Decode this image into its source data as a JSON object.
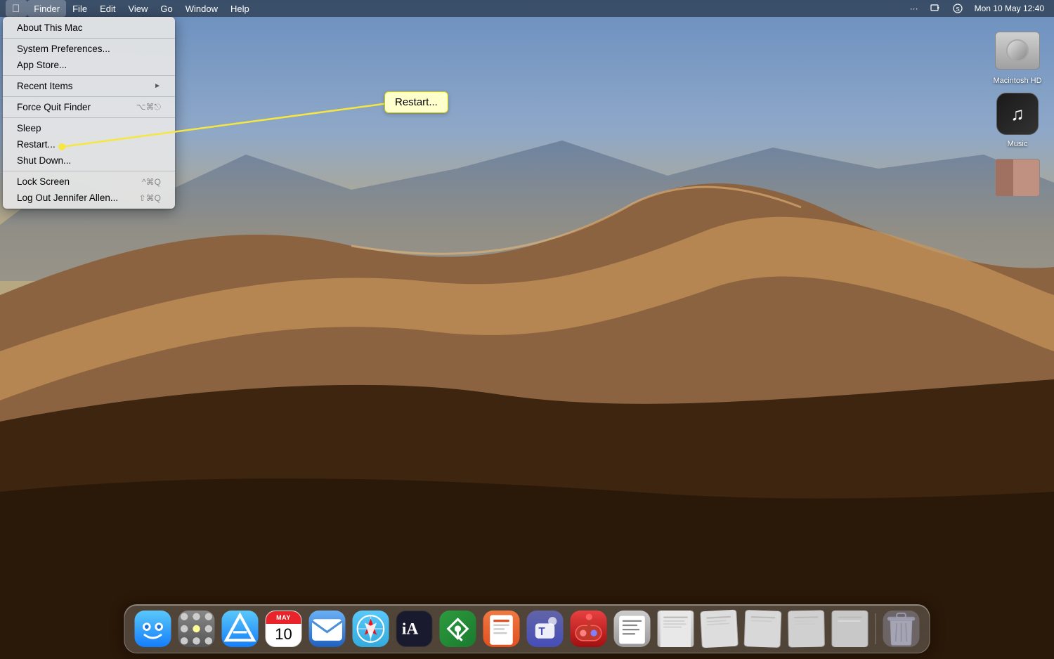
{
  "menubar": {
    "apple_label": "",
    "items": [
      {
        "label": "Finder",
        "active": true
      },
      {
        "label": "File"
      },
      {
        "label": "Edit"
      },
      {
        "label": "View"
      },
      {
        "label": "Go"
      },
      {
        "label": "Window"
      },
      {
        "label": "Help"
      }
    ],
    "right_items": [
      {
        "label": "···",
        "name": "control-strip"
      },
      {
        "label": "📷",
        "name": "screen-record"
      },
      {
        "label": "🔊",
        "name": "siri"
      },
      {
        "label": "Mon 10 May  12:40",
        "name": "clock"
      }
    ]
  },
  "apple_menu": {
    "items": [
      {
        "label": "About This Mac",
        "shortcut": "",
        "type": "item",
        "name": "about-this-mac"
      },
      {
        "type": "separator"
      },
      {
        "label": "System Preferences...",
        "shortcut": "",
        "type": "item",
        "name": "system-preferences"
      },
      {
        "label": "App Store...",
        "shortcut": "",
        "type": "item",
        "name": "app-store"
      },
      {
        "type": "separator"
      },
      {
        "label": "Recent Items",
        "shortcut": "▶",
        "type": "submenu",
        "name": "recent-items"
      },
      {
        "type": "separator"
      },
      {
        "label": "Force Quit Finder",
        "shortcut": "⌥⌘⎋",
        "type": "item",
        "name": "force-quit"
      },
      {
        "type": "separator"
      },
      {
        "label": "Sleep",
        "shortcut": "",
        "type": "item",
        "name": "sleep"
      },
      {
        "label": "Restart...",
        "shortcut": "",
        "type": "item",
        "name": "restart",
        "highlighted": false
      },
      {
        "label": "Shut Down...",
        "shortcut": "",
        "type": "item",
        "name": "shut-down"
      },
      {
        "type": "separator"
      },
      {
        "label": "Lock Screen",
        "shortcut": "^⌘Q",
        "type": "item",
        "name": "lock-screen"
      },
      {
        "label": "Log Out Jennifer Allen...",
        "shortcut": "⇧⌘Q",
        "type": "item",
        "name": "log-out"
      }
    ]
  },
  "restart_callout": {
    "label": "Restart..."
  },
  "desktop_icons": [
    {
      "label": "Macintosh HD",
      "type": "hd"
    },
    {
      "label": "Music",
      "type": "music"
    },
    {
      "label": "",
      "type": "thumb"
    }
  ],
  "dock": {
    "items": [
      {
        "name": "finder",
        "label": "Finder",
        "type": "finder"
      },
      {
        "name": "launchpad",
        "label": "Launchpad",
        "type": "launchpad"
      },
      {
        "name": "app-store",
        "label": "App Store",
        "type": "appstore"
      },
      {
        "name": "calendar",
        "label": "Calendar",
        "type": "calendar",
        "day": "MAY",
        "date": "10"
      },
      {
        "name": "mail",
        "label": "Mail",
        "type": "mail",
        "color": "#4a90d9"
      },
      {
        "name": "safari",
        "label": "Safari",
        "type": "safari",
        "color": "#5ac8fa"
      },
      {
        "name": "ia-writer",
        "label": "iA Writer",
        "type": "ia",
        "color": "#333"
      },
      {
        "name": "keePass",
        "label": "KeePassXC",
        "type": "keePass",
        "color": "#2c9b3e"
      },
      {
        "name": "pages",
        "label": "Pages",
        "type": "pages",
        "color": "#ff7043"
      },
      {
        "name": "teams",
        "label": "Microsoft Teams",
        "type": "teams",
        "color": "#464eb8"
      },
      {
        "name": "joystick",
        "label": "Joystick",
        "type": "joystick",
        "color": "#c0392b"
      },
      {
        "name": "script-editor",
        "label": "Script Editor",
        "type": "script",
        "color": "#8a8a8a"
      },
      {
        "name": "preview1",
        "label": "",
        "type": "preview",
        "color": "#bbb"
      },
      {
        "name": "preview2",
        "label": "",
        "type": "preview2",
        "color": "#bbb"
      },
      {
        "name": "preview3",
        "label": "",
        "type": "preview3",
        "color": "#bbb"
      },
      {
        "name": "preview4",
        "label": "",
        "type": "preview4",
        "color": "#bbb"
      },
      {
        "name": "preview5",
        "label": "",
        "type": "preview5",
        "color": "#bbb"
      },
      {
        "name": "trash",
        "label": "Trash",
        "type": "trash"
      }
    ]
  },
  "annotation": {
    "line_color": "#f5e642",
    "callout_bg": "#ffffcc",
    "callout_border": "#cccc00"
  }
}
